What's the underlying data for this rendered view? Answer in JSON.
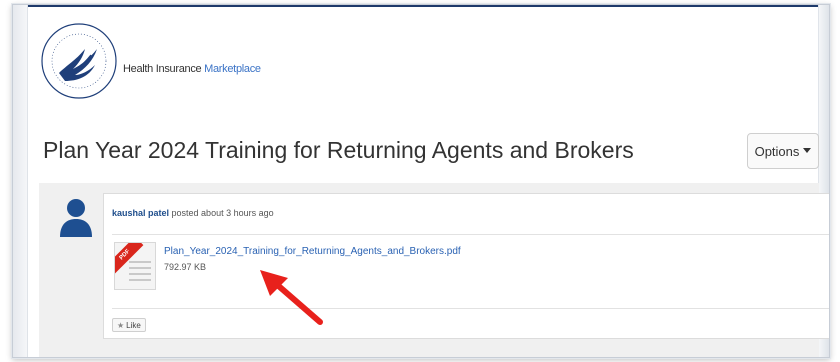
{
  "header": {
    "brand_text_plain": "Health Insurance ",
    "brand_text_accent": "Marketplace"
  },
  "page": {
    "title": "Plan Year 2024 Training for Returning Agents and Brokers"
  },
  "toolbar": {
    "options_label": "Options"
  },
  "post": {
    "author": "kaushal patel",
    "action_text": " posted about 3 hours ago",
    "attachment": {
      "filename": "Plan_Year_2024_Training_for_Returning_Agents_and_Brokers.pdf",
      "size": "792.97 KB",
      "badge": "PDF"
    },
    "like_label": "Like"
  },
  "colors": {
    "accent": "#3b73c6",
    "author": "#1f4e8c",
    "link": "#2a62b3",
    "arrow": "#e8211c",
    "pdf_badge": "#d9261c"
  },
  "icons": [
    "hhs-seal-icon",
    "avatar-icon",
    "pdf-file-icon",
    "star-icon",
    "chevron-down-icon",
    "pointer-arrow-icon"
  ]
}
